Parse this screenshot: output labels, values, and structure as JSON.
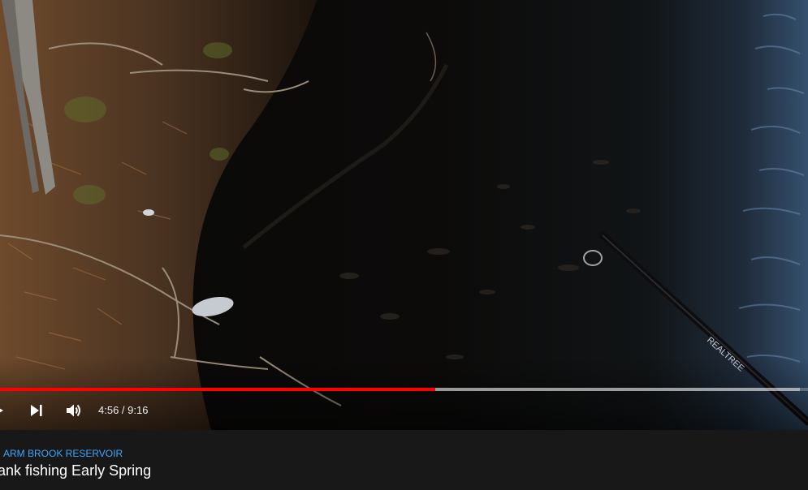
{
  "video": {
    "current_time": "4:56",
    "duration": "9:16",
    "time_display": "4:56 / 9:16",
    "progress_played": 0.539,
    "progress_loaded": 0.99
  },
  "meta": {
    "hashtag": "ARM BROOK RESERVOIR",
    "title": "ank fishing Early Spring"
  },
  "icons": {
    "play": "play-icon",
    "next": "skip-next-icon",
    "volume": "volume-icon"
  },
  "colors": {
    "progress_played": "#ff0000",
    "hashtag": "#3ea6ff",
    "background": "#181818"
  }
}
